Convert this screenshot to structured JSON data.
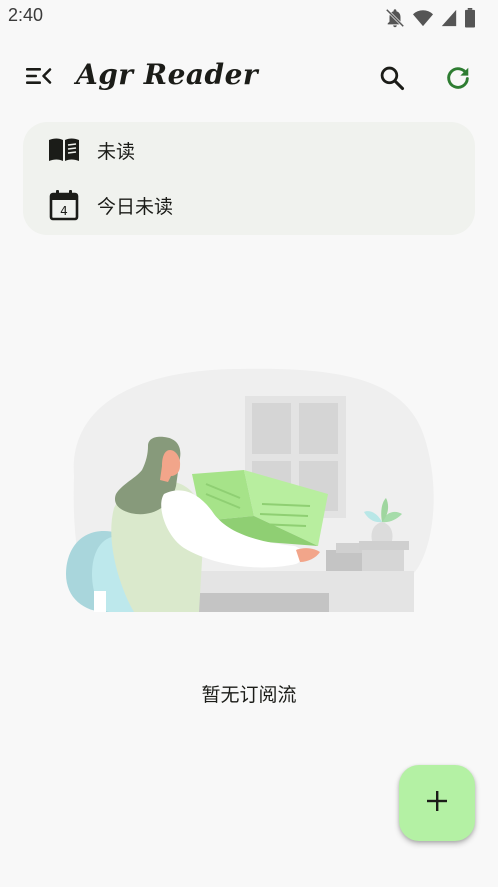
{
  "status_bar": {
    "time": "2:40",
    "icons": [
      "notifications-off-icon",
      "wifi-icon",
      "signal-icon",
      "battery-icon"
    ]
  },
  "app_bar": {
    "title": "Agr Reader",
    "menu_icon": "menu-collapse-icon",
    "search_icon": "search-icon",
    "refresh_icon": "refresh-icon"
  },
  "filters": {
    "items": [
      {
        "label": "未读",
        "icon": "open-book-icon"
      },
      {
        "label": "今日未读",
        "icon": "calendar-today-icon",
        "day": "4"
      }
    ]
  },
  "empty_state": {
    "message": "暂无订阅流"
  },
  "fab": {
    "icon": "add-icon"
  },
  "colors": {
    "background": "#f8f8f8",
    "card": "#f0f2ee",
    "accent_green": "#2e7d32",
    "fab": "#b4f1a4"
  }
}
